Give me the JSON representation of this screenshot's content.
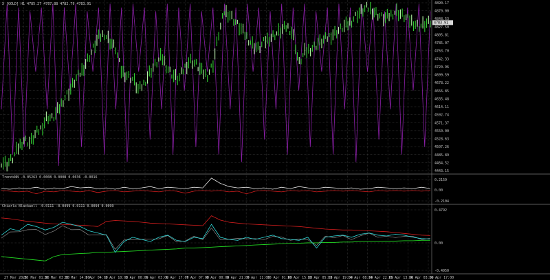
{
  "chart_data": [
    {
      "type": "line",
      "title": "",
      "header": "X [GOLD] H1 4785.27 4787.88 4782.79 4783.91",
      "ylim": [
        4430,
        4890
      ],
      "y_ticks": [
        "4890.17",
        "4870.00",
        "4848.53",
        "4827.50",
        "4805.81",
        "4785.07",
        "4763.70",
        "4742.33",
        "4720.96",
        "4699.59",
        "4678.22",
        "4656.85",
        "4635.48",
        "4614.11",
        "4592.74",
        "4571.37",
        "4550.00",
        "4528.63",
        "4507.26",
        "4485.89",
        "4464.52",
        "4443.15"
      ],
      "current_price": "4783.91",
      "series": [
        {
          "name": "",
          "values": [
            4460,
            4455,
            4470,
            4500,
            4520,
            4510,
            4535,
            4550,
            4580,
            4575,
            4600,
            4630,
            4650,
            4680,
            4700,
            4730,
            4760,
            4790,
            4800,
            4780,
            4760,
            4700,
            4690,
            4680,
            4650,
            4670,
            4700,
            4720,
            4740,
            4710,
            4690,
            4680,
            4710,
            4730,
            4720,
            4700,
            4690,
            4720,
            4800,
            4860,
            4850,
            4830,
            4810,
            4790,
            4770,
            4760,
            4780,
            4790,
            4800,
            4810,
            4820,
            4800,
            4720,
            4750,
            4760,
            4770,
            4780,
            4790,
            4800,
            4810,
            4820,
            4830,
            4850,
            4860,
            4870,
            4860,
            4850,
            4840,
            4850,
            4860,
            4850,
            4840,
            4830,
            4820,
            4825,
            4830
          ]
        },
        {
          "name": "",
          "values": [
            4600,
            4880,
            4480,
            4870,
            4500,
            4860,
            4700,
            4870,
            4600,
            4880,
            4450,
            4870,
            4650,
            4880,
            4500,
            4860,
            4700,
            4870,
            4480,
            4880,
            4600,
            4870,
            4460,
            4880,
            4700,
            4870,
            4520,
            4860,
            4600,
            4880,
            4480,
            4870,
            4650,
            4880,
            4500,
            4860,
            4700,
            4870,
            4480,
            4880,
            4600,
            4870,
            4460,
            4880,
            4700,
            4870,
            4520,
            4860,
            4600,
            4880,
            4480,
            4870,
            4650,
            4880,
            4500,
            4860,
            4700,
            4870,
            4480,
            4880,
            4600,
            4870,
            4460,
            4880,
            4700,
            4870,
            4520,
            4860,
            4600,
            4880,
            4480,
            4870,
            4650,
            4880,
            4500,
            4860
          ]
        }
      ]
    },
    {
      "type": "line",
      "title": "",
      "header": "TrendsNN -0.05263 0.0008 0.0008 0.0036 -0.0016",
      "ylim": [
        -0.21,
        0.21
      ],
      "y_ticks": [
        "0.2159",
        "0.00",
        "-0.2104"
      ],
      "series": [
        {
          "name": "",
          "values": [
            0.02,
            0.01,
            0.03,
            0.02,
            0.04,
            0.01,
            0.03,
            0.02,
            0.05,
            0.03,
            0.04,
            0.02,
            0.03,
            0.01,
            0.04,
            0.02,
            0.03,
            0.05,
            0.02,
            0.04,
            0.03,
            0.02,
            0.04,
            0.03,
            0.18,
            0.1,
            0.05,
            0.03,
            0.04,
            0.02,
            0.03,
            0.01,
            0.04,
            0.02,
            0.05,
            0.03,
            0.02,
            0.04,
            0.03,
            0.02,
            0.03,
            0.01,
            0.02,
            0.04,
            0.03,
            0.02,
            0.03,
            0.02,
            0.04,
            0.02
          ]
        },
        {
          "name": "",
          "values": [
            -0.01,
            -0.02,
            -0.03,
            -0.02,
            -0.06,
            -0.02,
            -0.03,
            -0.01,
            -0.02,
            -0.03,
            -0.01,
            -0.04,
            -0.02,
            -0.01,
            -0.03,
            -0.02,
            -0.01,
            -0.02,
            -0.03,
            -0.01,
            -0.02,
            -0.05,
            -0.02,
            -0.01,
            -0.02,
            -0.01,
            -0.03,
            -0.02,
            -0.06,
            -0.02,
            -0.01,
            -0.02,
            -0.03,
            -0.01,
            -0.02,
            -0.01,
            -0.03,
            -0.02,
            -0.01,
            -0.02,
            -0.01,
            -0.02,
            -0.03,
            -0.01,
            -0.02,
            -0.01,
            -0.02,
            -0.01,
            -0.02,
            -0.01
          ]
        }
      ]
    },
    {
      "type": "line",
      "title": "",
      "header": "Chiarla Blackwell -0.0111 -0.0499 0.0111 0.0094 0.0099",
      "ylim": [
        -0.8,
        0.8
      ],
      "y_ticks": [
        "0.4792",
        "0.00",
        "-0.4950"
      ],
      "series": [
        {
          "name": "",
          "values": [
            0.1,
            0.25,
            0.2,
            0.35,
            0.3,
            0.22,
            0.28,
            0.4,
            0.35,
            0.3,
            0.2,
            0.15,
            0.1,
            -0.3,
            -0.05,
            0.05,
            0.0,
            -0.05,
            0.05,
            0.1,
            -0.02,
            -0.05,
            0.05,
            0.02,
            0.35,
            0.05,
            0.0,
            -0.02,
            0.05,
            0.0,
            0.05,
            0.1,
            0.02,
            0.0,
            -0.02,
            0.05,
            -0.2,
            0.05,
            0.08,
            0.1,
            0.05,
            0.12,
            0.15,
            0.1,
            0.08,
            0.12,
            0.1,
            0.05,
            0.02,
            0.01
          ]
        },
        {
          "name": "",
          "values": [
            0.5,
            0.48,
            0.45,
            0.42,
            0.4,
            0.38,
            0.36,
            0.35,
            0.34,
            0.33,
            0.32,
            0.3,
            0.42,
            0.44,
            0.43,
            0.42,
            0.4,
            0.38,
            0.37,
            0.36,
            0.35,
            0.34,
            0.33,
            0.32,
            0.55,
            0.45,
            0.4,
            0.38,
            0.36,
            0.35,
            0.34,
            0.33,
            0.32,
            0.31,
            0.3,
            0.28,
            0.26,
            0.24,
            0.23,
            0.22,
            0.22,
            0.21,
            0.2,
            0.19,
            0.18,
            0.16,
            0.14,
            0.12,
            0.1,
            0.09
          ]
        },
        {
          "name": "",
          "values": [
            -0.4,
            -0.42,
            -0.44,
            -0.46,
            -0.48,
            -0.5,
            -0.4,
            -0.35,
            -0.34,
            -0.33,
            -0.32,
            -0.3,
            -0.3,
            -0.29,
            -0.28,
            -0.27,
            -0.26,
            -0.25,
            -0.24,
            -0.23,
            -0.22,
            -0.2,
            -0.2,
            -0.19,
            -0.18,
            -0.17,
            -0.16,
            -0.15,
            -0.14,
            -0.13,
            -0.12,
            -0.11,
            -0.1,
            -0.09,
            -0.09,
            -0.08,
            -0.08,
            -0.07,
            -0.07,
            -0.06,
            -0.06,
            -0.05,
            -0.05,
            -0.05,
            -0.04,
            -0.04,
            -0.03,
            -0.03,
            -0.02,
            -0.02
          ]
        }
      ]
    }
  ],
  "x_labels": [
    "27 Mar 2026",
    "30 Mar 01:00",
    "31 Mar 03:00",
    "31 Mar 14:00",
    "1 Apr 04:00",
    "2 Apr 10:00",
    "3 Apr 00:00",
    "6 Apr 03:00",
    "6 Apr 17:00",
    "7 Apr 07:00",
    "8 Apr 00:00",
    "8 Apr 21:00",
    "9 Apr 11:00",
    "10 Apr 01:00",
    "10 Apr 15:00",
    "13 Apr 05:00",
    "13 Apr 19:00",
    "14 Apr 08:00",
    "14 Apr 22:00",
    "15 Apr 13:00",
    "16 Apr 03:00",
    "16 Apr 17:00"
  ],
  "colors": {
    "background": "#000000",
    "grid": "#3c3c3c",
    "candle": "#32cd32",
    "candle_hi": "#b8f5a8",
    "purple": "#8b1fa8",
    "white": "#e8e8e8",
    "red": "#d81e1e",
    "cyan": "#2fd8d8",
    "gray": "#8c8c8c",
    "green": "#22d822"
  }
}
